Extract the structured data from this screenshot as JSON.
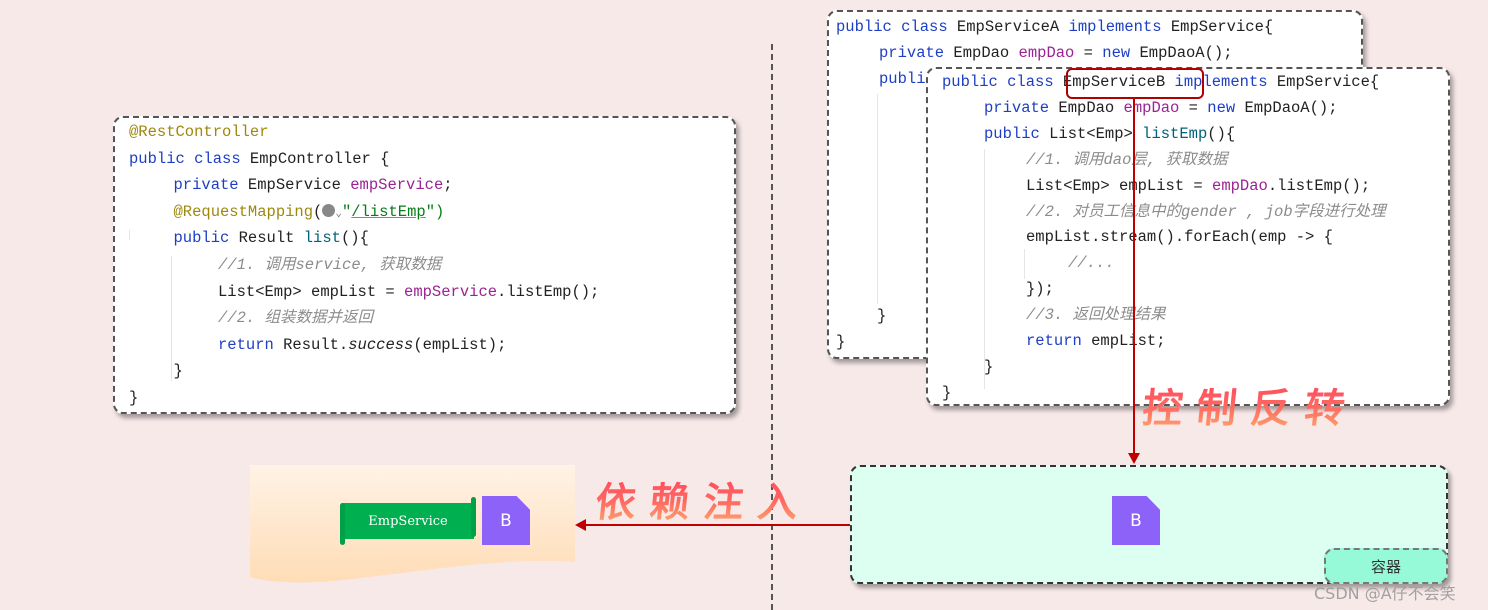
{
  "left_code": {
    "lines": [
      {
        "indent": 0,
        "parts": [
          {
            "t": "@RestController",
            "c": "ann"
          }
        ]
      },
      {
        "indent": 0,
        "parts": [
          {
            "t": "public class ",
            "c": "kw"
          },
          {
            "t": "EmpController {",
            "c": ""
          }
        ]
      },
      {
        "indent": 1,
        "parts": [
          {
            "t": "private ",
            "c": "kw"
          },
          {
            "t": "EmpService ",
            "c": ""
          },
          {
            "t": "empService",
            "c": "fld"
          },
          {
            "t": ";",
            "c": ""
          }
        ]
      },
      {
        "indent": 1,
        "parts": [
          {
            "t": "@RequestMapping",
            "c": "ann"
          },
          {
            "t": "(",
            "c": ""
          },
          {
            "t": "@globe",
            "c": "globe"
          },
          {
            "t": "\"",
            "c": "strq"
          },
          {
            "t": "/listEmp",
            "c": "str"
          },
          {
            "t": "\")",
            "c": "strq"
          }
        ]
      },
      {
        "indent": 1,
        "parts": [
          {
            "t": "public ",
            "c": "kw"
          },
          {
            "t": "Result ",
            "c": ""
          },
          {
            "t": "list",
            "c": "fn"
          },
          {
            "t": "(){",
            "c": ""
          }
        ]
      },
      {
        "indent": 2,
        "parts": [
          {
            "t": "//1. 调用service, 获取数据",
            "c": "cmt"
          }
        ]
      },
      {
        "indent": 2,
        "parts": [
          {
            "t": "List<Emp> empList = ",
            "c": ""
          },
          {
            "t": "empService",
            "c": "fld"
          },
          {
            "t": ".listEmp();",
            "c": ""
          }
        ]
      },
      {
        "indent": 2,
        "parts": [
          {
            "t": "//2. 组装数据并返回",
            "c": "cmt"
          }
        ]
      },
      {
        "indent": 2,
        "parts": [
          {
            "t": "return ",
            "c": "kw"
          },
          {
            "t": "Result.",
            "c": ""
          },
          {
            "t": "success",
            "c": "it"
          },
          {
            "t": "(empList);",
            "c": ""
          }
        ]
      },
      {
        "indent": 1,
        "parts": [
          {
            "t": "}",
            "c": ""
          }
        ]
      },
      {
        "indent": 0,
        "parts": [
          {
            "t": "}",
            "c": ""
          }
        ]
      }
    ]
  },
  "service_a_code": {
    "lines": [
      {
        "indent": 0,
        "parts": [
          {
            "t": "public class ",
            "c": "kw"
          },
          {
            "t": "EmpServiceA ",
            "c": ""
          },
          {
            "t": "implements ",
            "c": "kw"
          },
          {
            "t": "EmpService{",
            "c": ""
          }
        ]
      },
      {
        "indent": 1,
        "parts": [
          {
            "t": "private ",
            "c": "kw"
          },
          {
            "t": "EmpDao ",
            "c": ""
          },
          {
            "t": "empDao",
            "c": "fld"
          },
          {
            "t": " = ",
            "c": ""
          },
          {
            "t": "new ",
            "c": "kw"
          },
          {
            "t": "EmpDaoA();",
            "c": ""
          }
        ]
      },
      {
        "indent": 1,
        "parts": [
          {
            "t": "publi",
            "c": "kw"
          }
        ]
      }
    ],
    "closing_inner": "}",
    "closing_outer": "}"
  },
  "service_b_code": {
    "lines": [
      {
        "indent": 0,
        "parts": [
          {
            "t": "public class ",
            "c": "kw"
          },
          {
            "t": "EmpServiceB",
            "c": ""
          },
          {
            "t": " implements ",
            "c": "kw"
          },
          {
            "t": "EmpService{",
            "c": ""
          }
        ]
      },
      {
        "indent": 1,
        "parts": [
          {
            "t": "private ",
            "c": "kw"
          },
          {
            "t": "EmpDao ",
            "c": ""
          },
          {
            "t": "empDao",
            "c": "fld"
          },
          {
            "t": " = ",
            "c": ""
          },
          {
            "t": "new ",
            "c": "kw"
          },
          {
            "t": "EmpDaoA();",
            "c": ""
          }
        ]
      },
      {
        "indent": 1,
        "parts": [
          {
            "t": "public ",
            "c": "kw"
          },
          {
            "t": "List<Emp> ",
            "c": ""
          },
          {
            "t": "listEmp",
            "c": "fn"
          },
          {
            "t": "(){",
            "c": ""
          }
        ]
      },
      {
        "indent": 2,
        "parts": [
          {
            "t": "//1. 调用dao层, 获取数据",
            "c": "cmt"
          }
        ]
      },
      {
        "indent": 2,
        "parts": [
          {
            "t": "List<Emp> empList = ",
            "c": ""
          },
          {
            "t": "empDao",
            "c": "fld"
          },
          {
            "t": ".listEmp();",
            "c": ""
          }
        ]
      },
      {
        "indent": 2,
        "parts": [
          {
            "t": "//2. 对员工信息中的gender , job字段进行处理",
            "c": "cmt"
          }
        ]
      },
      {
        "indent": 2,
        "parts": [
          {
            "t": "empList.stream().forEach(emp -> {",
            "c": ""
          }
        ]
      },
      {
        "indent": 3,
        "parts": [
          {
            "t": "//...",
            "c": "cmt"
          }
        ]
      },
      {
        "indent": 2,
        "parts": [
          {
            "t": "});",
            "c": ""
          }
        ]
      },
      {
        "indent": 2,
        "parts": [
          {
            "t": "//3. 返回处理结果",
            "c": "cmt"
          }
        ]
      },
      {
        "indent": 2,
        "parts": [
          {
            "t": "return ",
            "c": "kw"
          },
          {
            "t": "empList;",
            "c": ""
          }
        ]
      },
      {
        "indent": 1,
        "parts": [
          {
            "t": "}",
            "c": ""
          }
        ]
      },
      {
        "indent": 0,
        "parts": [
          {
            "t": "}",
            "c": ""
          }
        ]
      }
    ]
  },
  "labels": {
    "inversion_of_control": "控制反转",
    "dependency_injection": "依赖注入",
    "emp_service_banner": "EmpService",
    "bean_left": "B",
    "bean_container": "B",
    "container": "容器",
    "watermark": "CSDN @A仔不会笑"
  },
  "colors": {
    "background": "#f8e9e9",
    "arrow": "#c00000",
    "bean": "#8c62f8",
    "banner": "#00b050",
    "container_fill": "#dcfff2",
    "container_tag": "#96f9d8"
  }
}
